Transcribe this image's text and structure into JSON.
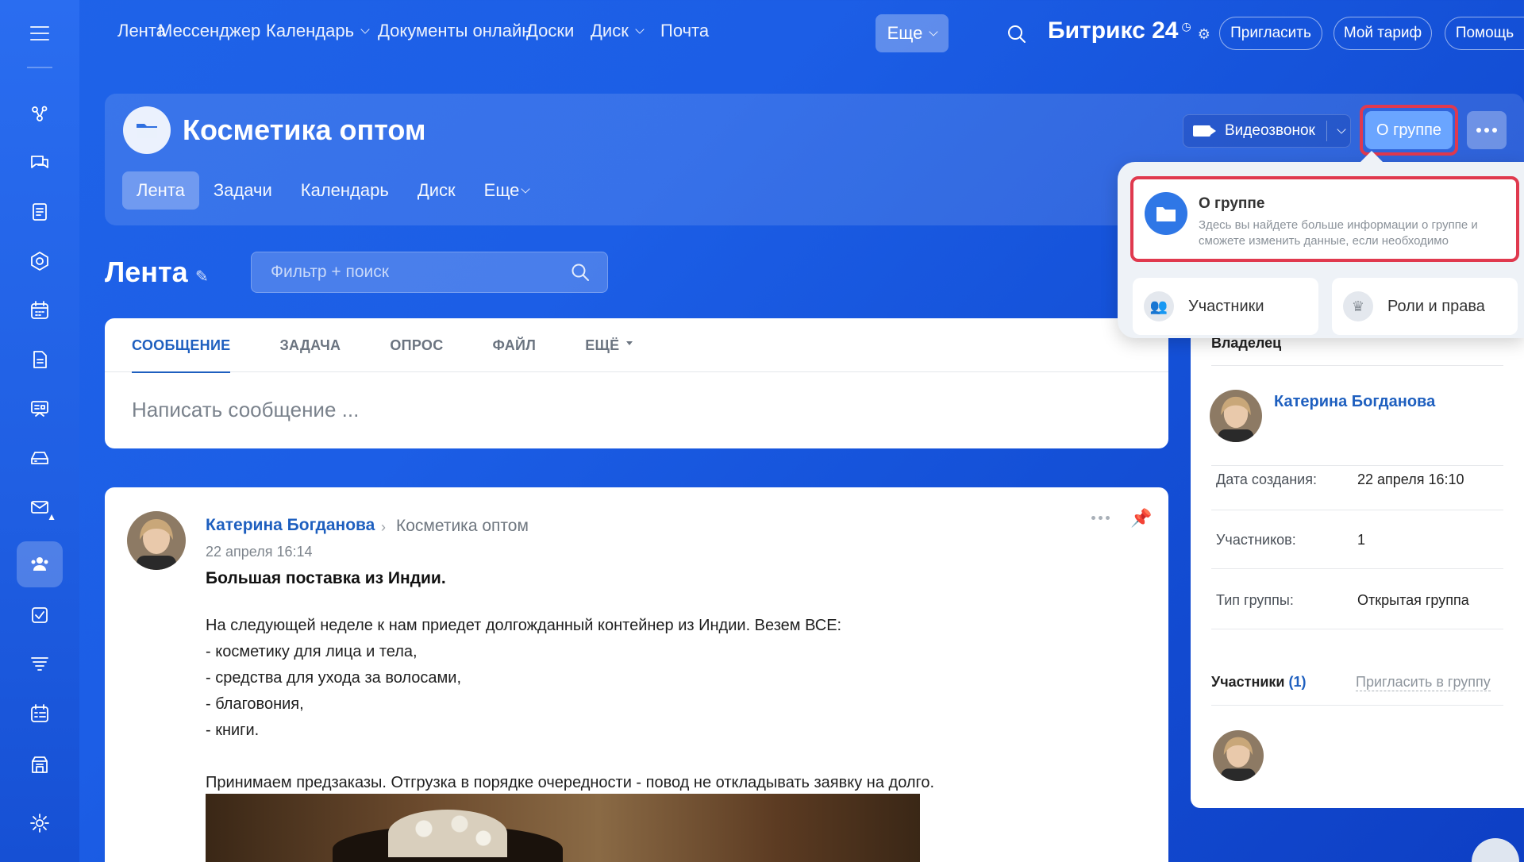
{
  "topnav": {
    "items": [
      {
        "label": "Лента",
        "caret": false
      },
      {
        "label": "Мессенджер",
        "caret": false
      },
      {
        "label": "Календарь",
        "caret": true
      },
      {
        "label": "Документы онлайн",
        "caret": false
      },
      {
        "label": "Доски",
        "caret": false
      },
      {
        "label": "Диск",
        "caret": true
      },
      {
        "label": "Почта",
        "caret": false
      }
    ],
    "more": "Еще",
    "brand": "Битрикс",
    "brand_num": "24",
    "invite": "Пригласить",
    "tariff": "Мой тариф",
    "help": "Помощь"
  },
  "group": {
    "title": "Косметика оптом",
    "tabs": [
      "Лента",
      "Задачи",
      "Календарь",
      "Диск",
      "Еще"
    ],
    "video_call": "Видеозвонок",
    "about": "О группе"
  },
  "feed": {
    "title": "Лента",
    "filter_placeholder": "Фильтр + поиск"
  },
  "composer": {
    "tabs": [
      "СООБЩЕНИЕ",
      "ЗАДАЧА",
      "ОПРОС",
      "ФАЙЛ",
      "ЕЩЁ"
    ],
    "placeholder": "Написать сообщение ..."
  },
  "post": {
    "author": "Катерина Богданова",
    "destination": "Косметика оптом",
    "date": "22 апреля 16:14",
    "subject": "Большая поставка из Индии.",
    "lines": [
      "На следующей неделе к нам приедет долгожданный контейнер из Индии. Везем ВСЕ:",
      "- косметику для лица и тела,",
      "- средства для ухода за волосами,",
      "- благовония,",
      "- книги.",
      "",
      "Принимаем предзаказы. Отгрузка в порядке очередности - повод не откладывать заявку на долго."
    ]
  },
  "sidebar": {
    "owner_heading": "Владелец",
    "owner_name": "Катерина Богданова",
    "created_label": "Дата создания:",
    "created_value": "22 апреля 16:10",
    "members_label": "Участников:",
    "members_value": "1",
    "type_label": "Тип группы:",
    "type_value": "Открытая группа",
    "members_heading": "Участники",
    "members_count": "(1)",
    "invite_link": "Пригласить в группу"
  },
  "popup": {
    "about_title": "О группе",
    "about_desc": "Здесь вы найдете больше информации о группе и сможете изменить данные, если необходимо",
    "members": "Участники",
    "roles": "Роли и права"
  },
  "colors": {
    "accent": "#1e5fbf",
    "highlight": "#e0394e",
    "bg": "#1c5ee6"
  }
}
